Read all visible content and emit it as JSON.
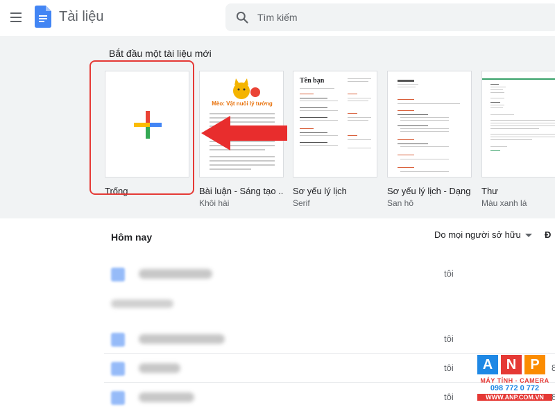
{
  "header": {
    "app_title": "Tài liệu",
    "search_placeholder": "Tìm kiếm"
  },
  "gallery": {
    "title": "Bắt đầu một tài liệu mới",
    "templates": [
      {
        "name": "Trống",
        "sub": ""
      },
      {
        "name": "Bài luận - Sáng tạo ...",
        "sub": "Khôi hài",
        "thumb_heading": "Mèo: Vật nuôi lý tưởng"
      },
      {
        "name": "Sơ yếu lý lịch",
        "sub": "Serif",
        "thumb_heading": "Tên bạn"
      },
      {
        "name": "Sơ yếu lý lịch - Dạng",
        "sub": "San hô"
      },
      {
        "name": "Thư",
        "sub": "Màu xanh lá"
      }
    ]
  },
  "recent": {
    "title": "Hôm nay",
    "owner_filter": "Do mọi người sở hữu",
    "extra_col": "Đ",
    "rows": [
      {
        "owner": "tôi",
        "date": ""
      },
      {
        "owner": "tôi",
        "date": ""
      },
      {
        "owner": "tôi",
        "date": "8"
      },
      {
        "owner": "tôi",
        "date": "8"
      }
    ]
  },
  "watermark": {
    "letters": [
      "A",
      "N",
      "P"
    ],
    "line1": "MÁY TÍNH - CAMERA",
    "line2": "098 772 0 772",
    "line3": "WWW.ANP.COM.VN"
  },
  "colors": {
    "accent_blue": "#4285f4",
    "highlight_red": "#e53935",
    "gallery_bg": "#f1f3f4"
  }
}
